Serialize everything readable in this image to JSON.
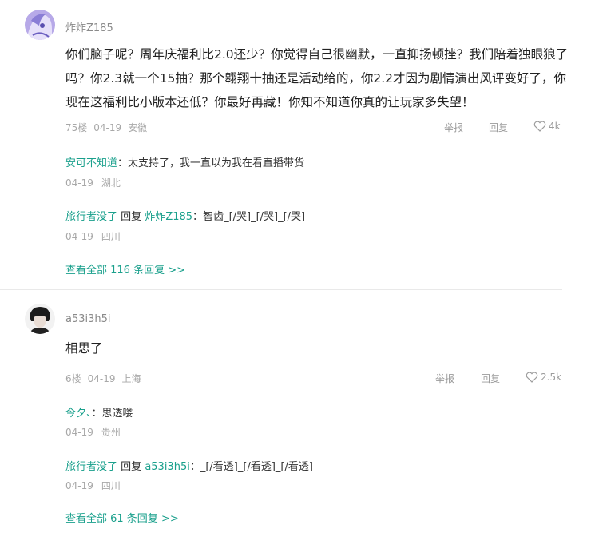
{
  "comments": [
    {
      "username": "炸炸Z185",
      "content": "你们脑子呢？周年庆福利比2.0还少？你觉得自己很幽默，一直抑扬顿挫？我们陪着独眼狼了吗？你2.3就一个15抽？那个翱翔十抽还是活动给的，你2.2才因为剧情演出风评变好了，你现在这福利比小版本还低？你最好再藏！你知不知道你真的让玩家多失望！",
      "floor": "75楼",
      "date": "04-19",
      "location": "安徽",
      "report": "举报",
      "reply": "回复",
      "likes": "4k",
      "replies": [
        {
          "name": "安可不知道",
          "reply_to_label": "",
          "reply_to": "",
          "sep": "：",
          "text": "太支持了，我一直以为我在看直播带货",
          "date": "04-19",
          "location": "湖北"
        },
        {
          "name": "旅行者没了",
          "reply_to_label": "回复",
          "reply_to": "炸炸Z185",
          "sep": "：",
          "text": "智齿_[/哭]_[/哭]_[/哭]",
          "date": "04-19",
          "location": "四川"
        }
      ],
      "view_all": "查看全部 116 条回复 >>"
    },
    {
      "username": "a53i3h5i",
      "content": "相思了",
      "floor": "6楼",
      "date": "04-19",
      "location": "上海",
      "report": "举报",
      "reply": "回复",
      "likes": "2.5k",
      "replies": [
        {
          "name": "今夕、",
          "reply_to_label": "",
          "reply_to": "",
          "sep": "：",
          "text": "思透喽",
          "date": "04-19",
          "location": "贵州"
        },
        {
          "name": "旅行者没了",
          "reply_to_label": "回复",
          "reply_to": "a53i3h5i",
          "sep": "：",
          "text": "_[/看透]_[/看透]_[/看透]",
          "date": "04-19",
          "location": "四川"
        }
      ],
      "view_all": "查看全部 61 条回复 >>"
    }
  ],
  "colors": {
    "accent": "#1aa08c",
    "meta": "#a8a8a8",
    "text": "#222222"
  }
}
